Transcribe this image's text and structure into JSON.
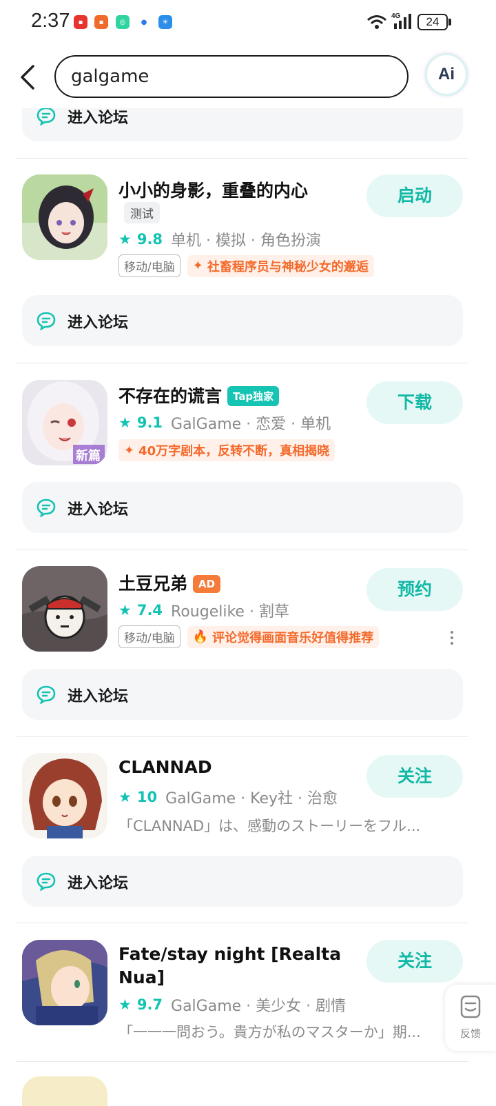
{
  "status_bar": {
    "time": "2:37",
    "battery": "24",
    "network": "4G"
  },
  "search": {
    "query": "galgame",
    "ai_label": "Ai"
  },
  "forum_label": "进入论坛",
  "apps": [
    {
      "title": "小小的身影，重叠的内心",
      "badge": "测试",
      "rating": "9.8",
      "tags_text": "单机 · 模拟 · 角色扮演",
      "platform": "移动/电脑",
      "highlight": "社畜程序员与神秘少女的邂逅",
      "action": "启动"
    },
    {
      "title": "不存在的谎言",
      "badge": "Tap独家",
      "rating": "9.1",
      "tags_text": "GalGame · 恋爱 · 单机",
      "highlight": "40万字剧本，反转不断，真相揭晓",
      "action": "下载"
    },
    {
      "title": "土豆兄弟",
      "badge": "AD",
      "rating": "7.4",
      "tags_text": "Rougelike · 割草",
      "platform": "移动/电脑",
      "highlight": "评论觉得画面音乐好值得推荐",
      "action": "预约"
    },
    {
      "title": "CLANNAD",
      "rating": "10",
      "tags_text": "GalGame · Key社 · 治愈",
      "description": "「CLANNAD」は、感動のストーリーをフル...",
      "action": "关注"
    },
    {
      "title_line1": "Fate/stay night [Realta",
      "title_line2": "Nua]",
      "rating": "9.7",
      "tags_text": "GalGame · 美少女 · 剧情",
      "description": "「一一一問おう。貴方が私のマスターか」期...",
      "action": "关注"
    }
  ],
  "feedback_label": "反馈",
  "colors": {
    "accent": "#13c3b2",
    "orange": "#f46a2b",
    "button_bg": "#e6f8f5"
  }
}
